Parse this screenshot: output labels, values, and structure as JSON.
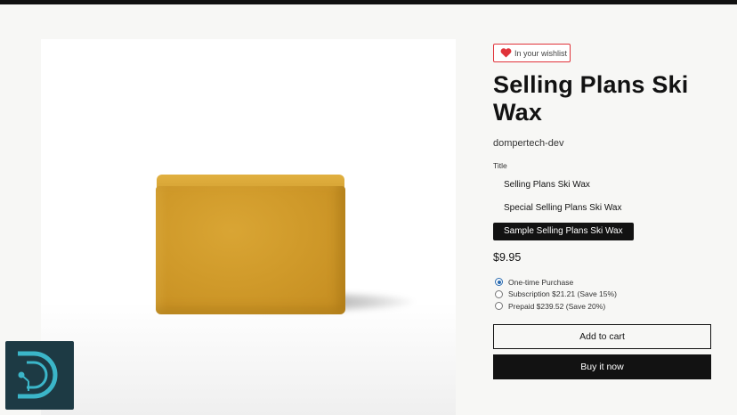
{
  "wishlist": {
    "label": "In your wishlist",
    "icon": "heart-icon",
    "color": "#e0333a"
  },
  "product": {
    "title": "Selling Plans Ski Wax",
    "vendor": "dompertech-dev",
    "option_label": "Title",
    "variants": [
      {
        "label": "Selling Plans Ski Wax",
        "selected": false
      },
      {
        "label": "Special Selling Plans Ski Wax",
        "selected": false
      },
      {
        "label": "Sample Selling Plans Ski Wax",
        "selected": true
      }
    ],
    "price": "$9.95",
    "plans": [
      {
        "label": "One-time Purchase",
        "checked": true
      },
      {
        "label": "Subscription $21.21 (Save 15%)",
        "checked": false
      },
      {
        "label": "Prepaid $239.52 (Save 20%)",
        "checked": false
      }
    ]
  },
  "actions": {
    "add_to_cart": "Add to cart",
    "buy_now": "Buy it now"
  },
  "colors": {
    "accent": "#121212",
    "radio": "#2a6bb0",
    "wax": "#d09a2a",
    "logo_bg": "#1d3a44",
    "logo_fg": "#3bb6c9"
  }
}
